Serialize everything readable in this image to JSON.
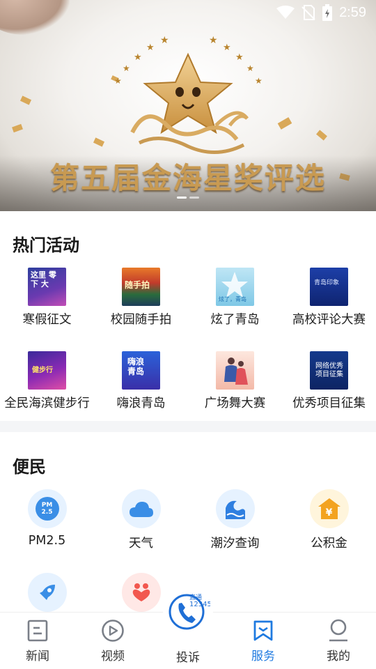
{
  "status_bar": {
    "time": "2:59",
    "icons": [
      "wifi-icon",
      "no-sim-icon",
      "battery-charging-icon"
    ]
  },
  "banner": {
    "title": "第五届金海星奖评选",
    "slides": 2,
    "active_slide": 1
  },
  "hot_activities": {
    "title": "热门活动",
    "items": [
      {
        "label": "寒假征文",
        "thumb_text": "这里 零 下 大"
      },
      {
        "label": "校园随手拍",
        "thumb_text": "随手拍"
      },
      {
        "label": "炫了青岛",
        "thumb_text": "炫了，青岛"
      },
      {
        "label": "高校评论大赛",
        "thumb_text": "青岛印象"
      },
      {
        "label": "全民海滨健步行",
        "thumb_text": "健步行"
      },
      {
        "label": "嗨浪青岛",
        "thumb_text": "嗨浪 青岛"
      },
      {
        "label": "广场舞大赛",
        "thumb_text": ""
      },
      {
        "label": "优秀项目征集",
        "thumb_text": "网络优秀 项目征集"
      }
    ]
  },
  "services": {
    "title": "便民",
    "items": [
      {
        "label": "PM2.5",
        "icon": "pm25-icon",
        "icon_text": "PM 2.5",
        "bg": "#e6f2ff"
      },
      {
        "label": "天气",
        "icon": "cloud-icon",
        "bg": "#e6f2ff"
      },
      {
        "label": "潮汐查询",
        "icon": "wave-icon",
        "bg": "#e6f2ff"
      },
      {
        "label": "公积金",
        "icon": "house-fund-icon",
        "icon_text": "¥",
        "bg": "#fff5dc"
      },
      {
        "label": "",
        "icon": "rocket-icon",
        "bg": "#e6f2ff"
      },
      {
        "label": "",
        "icon": "heart-people-icon",
        "bg": "#ffe8e6"
      }
    ]
  },
  "nav": {
    "items": [
      {
        "label": "新闻",
        "icon": "news-icon",
        "active": false
      },
      {
        "label": "视频",
        "icon": "play-icon",
        "active": false
      },
      {
        "label": "投诉",
        "icon": "hotline-phone-icon",
        "active": false,
        "badge_text": "直通 12345"
      },
      {
        "label": "服务",
        "icon": "service-bookmark-icon",
        "active": true
      },
      {
        "label": "我的",
        "icon": "profile-icon",
        "active": false
      }
    ]
  },
  "colors": {
    "accent": "#1f7ae0",
    "gold": "#c89a52"
  }
}
